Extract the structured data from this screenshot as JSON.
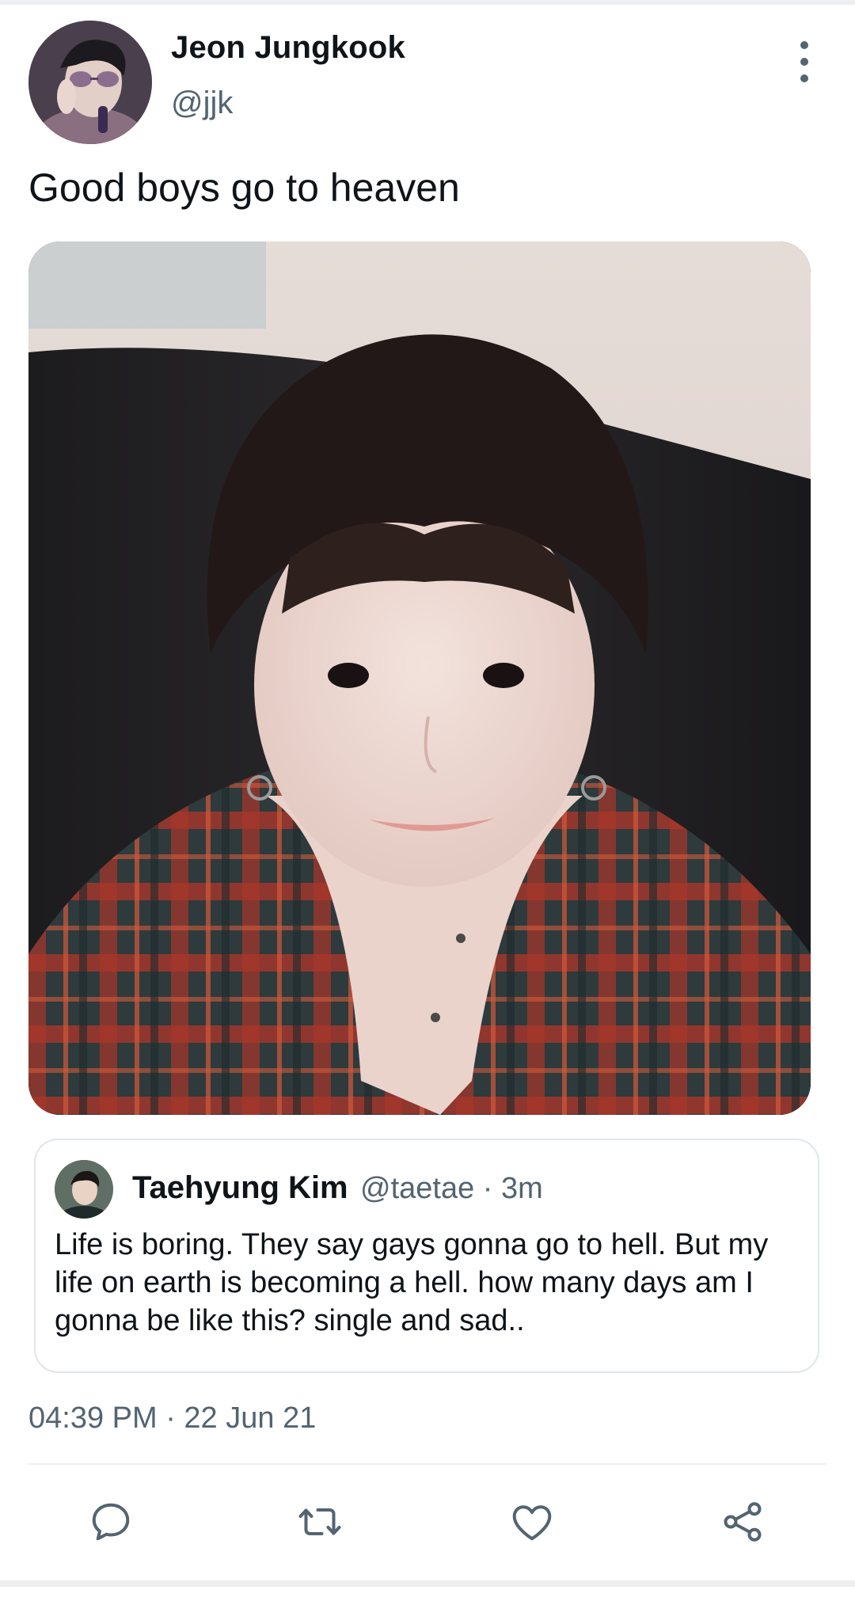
{
  "tweet": {
    "author": {
      "display_name": "Jeon Jungkook",
      "handle": "@jjk",
      "avatar_icon": "profile-photo"
    },
    "text": "Good boys go to heaven",
    "media": {
      "kind": "photo",
      "icon": "selfie-photo"
    },
    "quoted": {
      "author_name": "Taehyung Kim",
      "meta": "@taetae · 3m",
      "text": "Life is boring. They say gays gonna go to hell. But my life on earth is becoming a hell. how many days am I gonna be like this? single and sad.."
    },
    "timestamp": "04:39 PM · 22 Jun 21",
    "actions": [
      {
        "name": "reply",
        "icon": "reply-icon"
      },
      {
        "name": "retweet",
        "icon": "retweet-icon"
      },
      {
        "name": "like",
        "icon": "heart-icon"
      },
      {
        "name": "share",
        "icon": "share-icon"
      }
    ]
  },
  "colors": {
    "text_primary": "#0f1419",
    "text_secondary": "#536471",
    "border": "#e1e6ea",
    "icon": "#536471"
  }
}
